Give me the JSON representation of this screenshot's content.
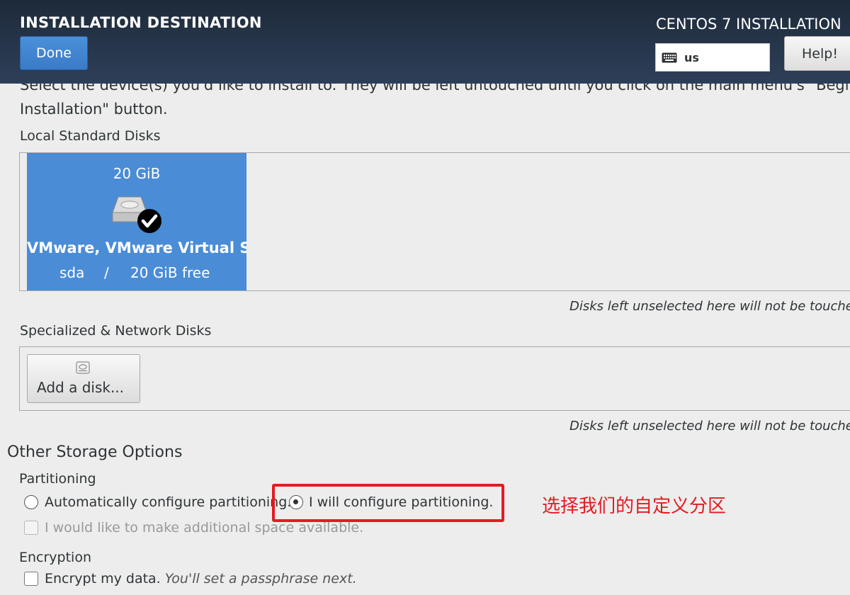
{
  "header": {
    "title": "INSTALLATION DESTINATION",
    "done_label": "Done",
    "product": "CENTOS 7 INSTALLATION",
    "keyboard_layout": "us",
    "help_label": "Help!"
  },
  "intro": {
    "line1_clipped": "Select the device(s) you'd like to install to.  They will be left untouched until you click on the main menu's \"Begin",
    "line2": "Installation\" button."
  },
  "local_disks": {
    "label": "Local Standard Disks",
    "disk": {
      "size": "20 GiB",
      "name": "VMware, VMware Virtual S",
      "device": "sda",
      "separator": "/",
      "free": "20 GiB free"
    },
    "note": "Disks left unselected here will not be touched."
  },
  "network_disks": {
    "label": "Specialized & Network Disks",
    "add_label": "Add a disk...",
    "note": "Disks left unselected here will not be touched."
  },
  "other": {
    "heading": "Other Storage Options",
    "partitioning_label": "Partitioning",
    "auto_label": "Automatically configure partitioning.",
    "manual_label": "I will configure partitioning.",
    "extra_space_label": "I would like to make additional space available.",
    "encryption_label": "Encryption",
    "encrypt_label": "Encrypt my data.",
    "encrypt_hint": "You'll set a passphrase next."
  },
  "annotation": {
    "text": "选择我们的自定义分区",
    "color": "#e31b23"
  },
  "colors": {
    "accent": "#4a8cd6",
    "header_bg": "#1e2a3a"
  }
}
